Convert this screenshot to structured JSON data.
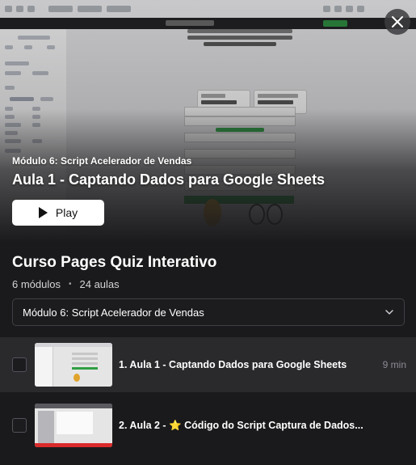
{
  "hero": {
    "module_label": "Módulo 6: Script Acelerador de Vendas",
    "lesson_title": "Aula 1 - Captando Dados para Google Sheets",
    "play_label": "Play"
  },
  "course": {
    "title": "Curso Pages Quiz Interativo",
    "modules_count": "6 módulos",
    "separator": "•",
    "lessons_count": "24 aulas"
  },
  "module_select": {
    "value": "Módulo 6: Script Acelerador de Vendas"
  },
  "lessons": [
    {
      "title": "1. Aula 1 - Captando Dados para Google Sheets",
      "duration": "9 min",
      "active": true
    },
    {
      "title_prefix": "2. Aula 2 -",
      "title_star": "⭐",
      "title_rest": "Código do Script Captura de Dados...",
      "duration": "",
      "active": false
    }
  ],
  "colors": {
    "background": "#1a1a1c",
    "active_row": "#2a2a2d",
    "play_button": "#ffffff",
    "star": "#f5c518"
  },
  "icons": {
    "close": "close-icon",
    "play": "play-icon",
    "dropdown": "chevron-down-icon",
    "star": "star-emoji"
  }
}
